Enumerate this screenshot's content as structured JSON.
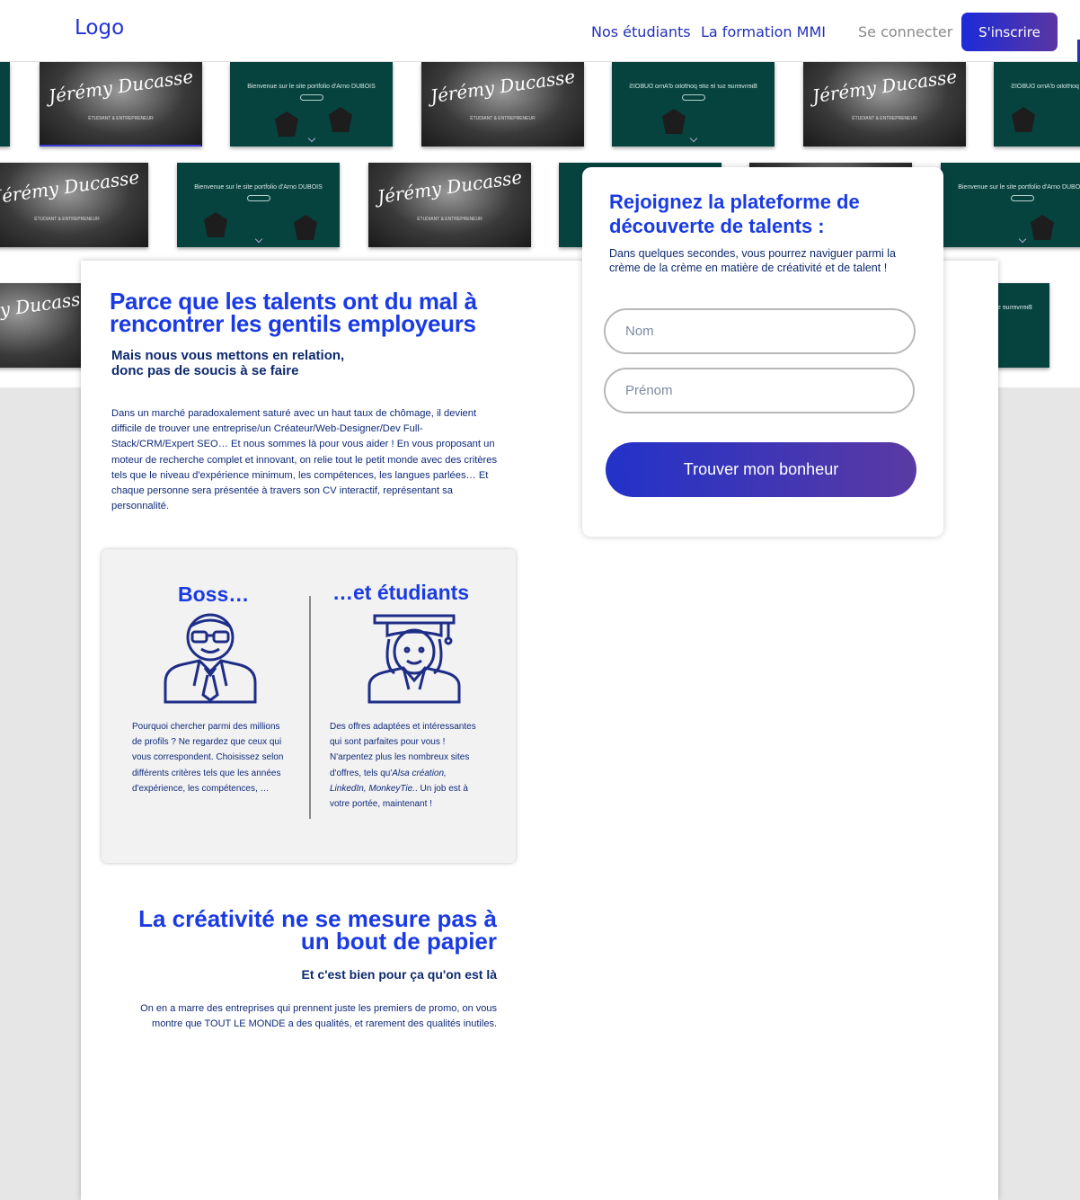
{
  "header": {
    "logo": "Logo",
    "nav": [
      "Nos étudiants",
      "La formation MMI"
    ],
    "login": "Se connecter",
    "signup": "S'inscrire"
  },
  "thumbnails": {
    "signature": "Jérémy Ducasse",
    "subtitle": "ÉTUDIANT & ENTREPRENEUR",
    "welcome": "Bienvenue sur le site portfolio d'Arno DUBOIS"
  },
  "intro": {
    "title": "Parce que les talents ont du mal à rencontrer les gentils employeurs",
    "subtitle_line1": "Mais nous vous mettons en relation,",
    "subtitle_line2": "donc pas de soucis à se faire",
    "paragraph": "Dans un marché paradoxalement saturé avec un haut taux de chômage, il devient difficile de trouver une entreprise/un Créateur/Web-Designer/Dev Full-Stack/CRM/Expert SEO… Et nous sommes là pour vous aider ! En vous proposant un moteur de recherche complet et innovant, on relie tout le petit monde avec des critères tels que le niveau d'expérience minimum, les compétences, les langues parlées… Et chaque personne sera présentée à travers son CV interactif, représentant sa personnalité."
  },
  "panel": {
    "boss_title": "Boss…",
    "boss_text": "Pourquoi chercher parmi des millions de profils ? Ne regardez que ceux qui vous correspondent. Choisissez selon différents critères tels que les années d'expérience, les compétences, …",
    "students_title": "…et étudiants",
    "students_text_before": "Des offres adaptées et intéressantes qui sont parfaites pour vous ! N'arpentez plus les nombreux sites d'offres, tels qu'",
    "students_text_italic": "Alsa création, LinkedIn, MonkeyTie.",
    "students_text_after": ". Un job est à votre portée, maintenant !"
  },
  "creativity": {
    "title": "La créativité ne se mesure pas à un bout de papier",
    "subtitle": "Et c'est bien pour ça qu'on est là",
    "paragraph": "On en a marre des entreprises qui prennent juste les premiers de promo, on vous montre que TOUT LE MONDE a des qualités, et rarement des qualités inutiles."
  },
  "signup_form": {
    "title": "Rejoignez la plateforme de découverte de talents :",
    "description": "Dans quelques secondes, vous pourrez naviguer parmi la crème de la crème en matière de créativité et de talent !",
    "name_placeholder": "Nom",
    "firstname_placeholder": "Prénom",
    "submit": "Trouver mon bonheur"
  },
  "colors": {
    "brand_blue": "#1a3be3",
    "navy": "#0e2a7a",
    "gradient_start": "#1c2bd8",
    "gradient_end": "#5b36a2"
  }
}
